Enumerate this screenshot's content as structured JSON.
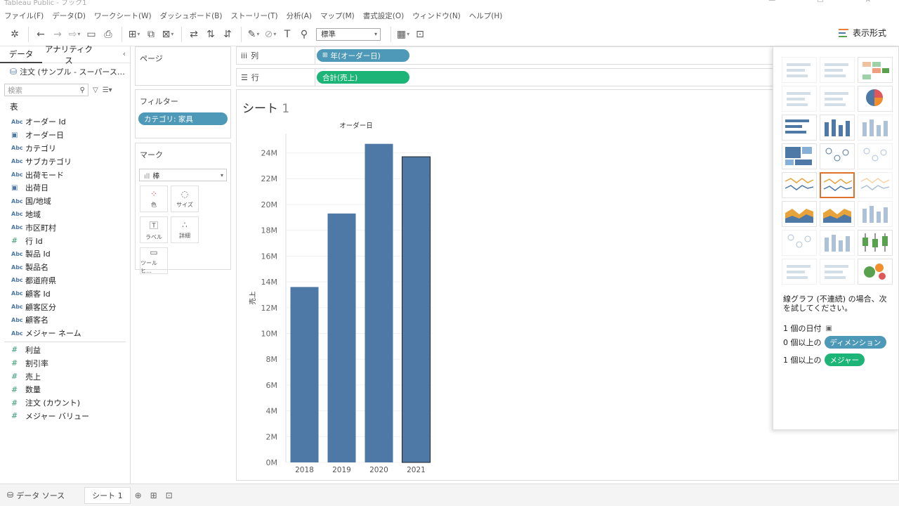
{
  "window": {
    "title": "Tableau Public - ブック1"
  },
  "menu": [
    "ファイル(F)",
    "データ(D)",
    "ワークシート(W)",
    "ダッシュボード(B)",
    "ストーリー(T)",
    "分析(A)",
    "マップ(M)",
    "書式設定(O)",
    "ウィンドウ(N)",
    "ヘルプ(H)"
  ],
  "toolbar": {
    "fit_select": "標準",
    "show_me_label": "表示形式"
  },
  "data_pane": {
    "tabs": [
      "データ",
      "アナリティクス"
    ],
    "datasource": "注文 (サンプル - スーパース…",
    "search_placeholder": "検索",
    "table_header": "表",
    "dimensions": [
      {
        "icon": "Abc",
        "name": "オーダー Id"
      },
      {
        "icon": "cal",
        "name": "オーダー日"
      },
      {
        "icon": "Abc",
        "name": "カテゴリ"
      },
      {
        "icon": "Abc",
        "name": "サブカテゴリ"
      },
      {
        "icon": "Abc",
        "name": "出荷モード"
      },
      {
        "icon": "cal",
        "name": "出荷日"
      },
      {
        "icon": "Abc",
        "name": "国/地域"
      },
      {
        "icon": "Abc",
        "name": "地域"
      },
      {
        "icon": "Abc",
        "name": "市区町村"
      },
      {
        "icon": "#",
        "name": "行 Id"
      },
      {
        "icon": "Abc",
        "name": "製品 Id"
      },
      {
        "icon": "Abc",
        "name": "製品名"
      },
      {
        "icon": "Abc",
        "name": "都道府県"
      },
      {
        "icon": "Abc",
        "name": "顧客 Id"
      },
      {
        "icon": "Abc",
        "name": "顧客区分"
      },
      {
        "icon": "Abc",
        "name": "顧客名"
      },
      {
        "icon": "Abc",
        "name": "メジャー ネーム"
      }
    ],
    "measures": [
      {
        "icon": "#",
        "name": "利益"
      },
      {
        "icon": "#",
        "name": "割引率"
      },
      {
        "icon": "#",
        "name": "売上"
      },
      {
        "icon": "#",
        "name": "数量"
      },
      {
        "icon": "#",
        "name": "注文 (カウント)"
      },
      {
        "icon": "#",
        "name": "メジャー バリュー"
      }
    ]
  },
  "cards": {
    "pages_title": "ページ",
    "filters_title": "フィルター",
    "filter_pill": "カテゴリ: 家具",
    "marks_title": "マーク",
    "marks_type": "棒",
    "mark_buttons": [
      {
        "icon": "dots-color-icon",
        "label": "色"
      },
      {
        "icon": "size-icon",
        "label": "サイズ"
      },
      {
        "icon": "label-icon",
        "label": "ラベル"
      },
      {
        "icon": "detail-icon",
        "label": "詳細"
      },
      {
        "icon": "tooltip-icon",
        "label": "ツールヒ…"
      }
    ]
  },
  "shelves": {
    "columns_label": "列",
    "columns_pill": "年(オーダー日)",
    "rows_label": "行",
    "rows_pill": "合計(売上)"
  },
  "sheet": {
    "title": "シート",
    "title_num": "1"
  },
  "chart_data": {
    "type": "bar",
    "title": "オーダー日",
    "xlabel": "",
    "ylabel": "売上",
    "categories": [
      "2018",
      "2019",
      "2020",
      "2021"
    ],
    "values": [
      13.6,
      19.3,
      24.7,
      23.7
    ],
    "unit": "M",
    "ylim": [
      0,
      25.5
    ],
    "yticks": [
      "0M",
      "2M",
      "4M",
      "6M",
      "8M",
      "10M",
      "12M",
      "14M",
      "16M",
      "18M",
      "20M",
      "22M",
      "24M"
    ],
    "bar_color": "#4e79a7",
    "grid": true
  },
  "show_me": {
    "hint": "線グラフ (不連続) の場合、次を試してください。",
    "req1_prefix": "1 個の日付",
    "req2_prefix": "0 個以上の",
    "req2_pill": "ディメンション",
    "req3_prefix": "1 個以上の",
    "req3_pill": "メジャー"
  },
  "bottom_tabs": {
    "datasource": "データ ソース",
    "sheet1": "シート 1"
  },
  "colors": {
    "dimension_pill": "#4e98b8",
    "measure_pill": "#1db477",
    "selected_chart": "#e07030"
  }
}
